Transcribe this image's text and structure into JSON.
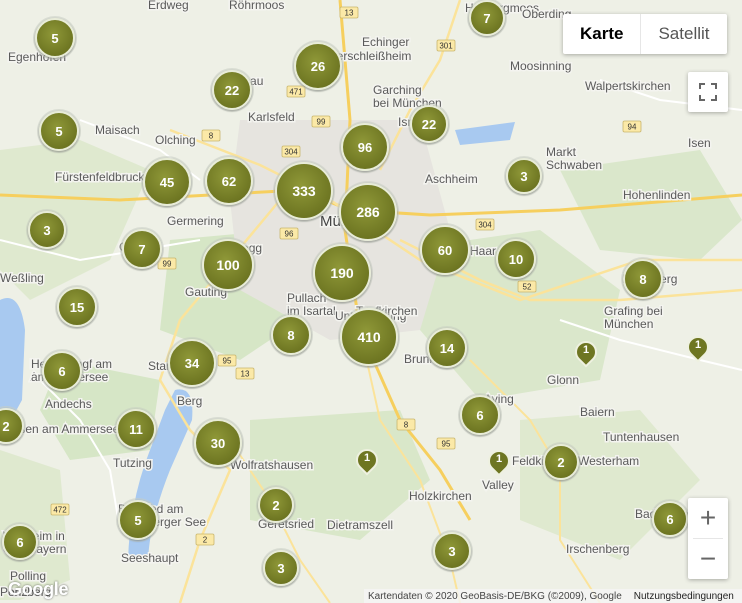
{
  "map_type_control": {
    "karte_label": "Karte",
    "satellit_label": "Satellit"
  },
  "zoom_control": {
    "in_label": "+",
    "out_label": "−"
  },
  "logo": "Google",
  "attribution": {
    "data_label": "Kartendaten © 2020 GeoBasis-DE/BKG (©2009), Google",
    "terms_label": "Nutzungsbedingungen"
  },
  "places": [
    "Erdweg",
    "Röhrmoos",
    "Hallbergmoos",
    "Oberding",
    "Egenhofen",
    "Echinger",
    "Unterschleißheim",
    "Dachau",
    "Garching bei München",
    "Moosinning",
    "Walpertskirchen",
    "Maisach",
    "Olching",
    "Karlsfeld",
    "Ismaning",
    "Markt Schwaben",
    "Isen",
    "Fürstenfeldbruck",
    "Aschheim",
    "Germering",
    "München",
    "Hohenlinden",
    "Gilching",
    "Planegg",
    "Haar",
    "Ebersberg",
    "Gauting",
    "Pullach im Isartal",
    "Unterhaching",
    "Grafing bei München",
    "Weßling",
    "Hechendorf am Ammersee",
    "Taufkirchen",
    "Brunnthal",
    "Starnberg",
    "Glonn",
    "Herrsching am Ammersee",
    "Andechs",
    "Berg",
    "Aying",
    "Baiern",
    "Tuntenhausen",
    "Dießen am Ammersee",
    "Tutzing",
    "Feldkirchen-Westerham",
    "Wolfratshausen",
    "Valley",
    "Holzkirchen",
    "Bernried am Starnberger See",
    "Geretsried",
    "Bad Aibling",
    "Weilheim in Oberbayern",
    "Dietramszell",
    "Seeshaupt",
    "Irschenberg",
    "Polling",
    "Penzberg"
  ],
  "roads": [
    "13",
    "301",
    "471",
    "99",
    "8",
    "304",
    "94",
    "96",
    "99",
    "304",
    "52",
    "95",
    "13",
    "8",
    "95",
    "2",
    "472"
  ],
  "clusters": [
    "5",
    "7",
    "26",
    "22",
    "22",
    "5",
    "96",
    "3",
    "45",
    "62",
    "333",
    "286",
    "3",
    "7",
    "100",
    "190",
    "60",
    "10",
    "8",
    "15",
    "8",
    "410",
    "14",
    "34",
    "6",
    "6",
    "11",
    "30",
    "5",
    "2",
    "6",
    "2",
    "3",
    "3",
    "6",
    "2"
  ],
  "pins": [
    "1",
    "1",
    "1",
    "1"
  ]
}
